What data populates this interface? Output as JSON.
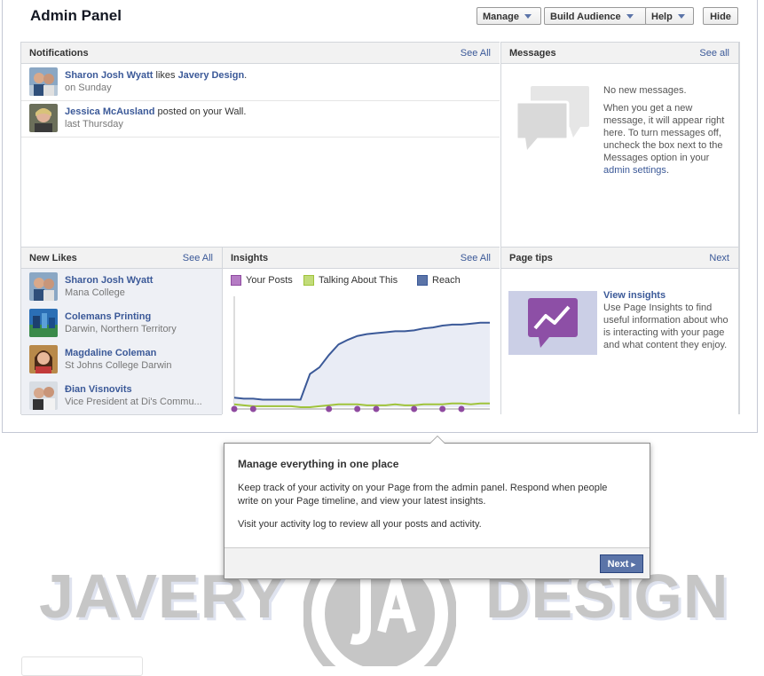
{
  "header": {
    "title": "Admin Panel",
    "manage_label": "Manage",
    "build_audience_label": "Build Audience",
    "help_label": "Help",
    "hide_label": "Hide"
  },
  "notifications": {
    "title": "Notifications",
    "see_all": "See All",
    "items": [
      {
        "name": "Sharon Josh Wyatt",
        "action": " likes ",
        "target": "Javery Design",
        "suffix": ".",
        "time": "on Sunday"
      },
      {
        "name": "Jessica McAusland",
        "action": " posted on your Wall.",
        "target": "",
        "suffix": "",
        "time": "last Thursday"
      }
    ]
  },
  "messages": {
    "title": "Messages",
    "see_all": "See all",
    "line1": "No new messages.",
    "body": "When you get a new message, it will appear right here. To turn messages off, uncheck the box next to the Messages option in your ",
    "link": "admin settings",
    "suffix": "."
  },
  "new_likes": {
    "title": "New Likes",
    "see_all": "See All",
    "items": [
      {
        "name": "Sharon Josh Wyatt",
        "sub": "Mana College"
      },
      {
        "name": "Colemans Printing",
        "sub": "Darwin, Northern Territory"
      },
      {
        "name": "Magdaline Coleman",
        "sub": "St Johns College Darwin"
      },
      {
        "name": "Đian Visnovits",
        "sub": "Vice President at Di's Commu..."
      }
    ]
  },
  "insights": {
    "title": "Insights",
    "see_all": "See All",
    "legend": [
      "Your Posts",
      "Talking About This",
      "Reach"
    ]
  },
  "chart_data": {
    "type": "line",
    "title": "",
    "xlabel": "",
    "ylabel": "",
    "x": [
      1,
      2,
      3,
      4,
      5,
      6,
      7,
      8,
      9,
      10,
      11,
      12,
      13,
      14,
      15,
      16,
      17,
      18,
      19,
      20,
      21,
      22,
      23,
      24,
      25,
      26,
      27,
      28
    ],
    "ylim": [
      0,
      100
    ],
    "series": [
      {
        "name": "Reach",
        "color": "#3b5998",
        "fill": "#e9ecf5",
        "values": [
          10,
          9,
          9,
          8,
          8,
          8,
          8,
          8,
          35,
          42,
          55,
          66,
          71,
          75,
          77,
          78,
          79,
          80,
          80,
          81,
          83,
          84,
          86,
          87,
          87,
          88,
          89,
          89
        ]
      },
      {
        "name": "Talking About This",
        "color": "#9fc33b",
        "values": [
          3,
          2,
          1,
          1,
          1,
          1,
          1,
          0,
          0,
          1,
          2,
          3,
          3,
          3,
          2,
          2,
          2,
          3,
          2,
          2,
          3,
          3,
          3,
          4,
          4,
          3,
          4,
          4
        ]
      },
      {
        "name": "Your Posts",
        "color": "#8f4ba0",
        "marker_x": [
          1,
          3,
          11,
          14,
          16,
          20,
          23,
          25
        ]
      }
    ]
  },
  "page_tips": {
    "title": "Page tips",
    "next": "Next",
    "tip_title": "View insights",
    "tip_body": "Use Page Insights to find useful information about who is interacting with your page and what content they enjoy."
  },
  "tooltip": {
    "title": "Manage everything in one place",
    "p1": "Keep track of your activity on your Page from the admin panel. Respond when people write on your Page timeline, and view your latest insights.",
    "p2": "Visit your activity log to review all your posts and activity.",
    "next_label": "Next"
  },
  "cover": {
    "left_text": "JAVERY",
    "right_text": "DESIGN"
  }
}
